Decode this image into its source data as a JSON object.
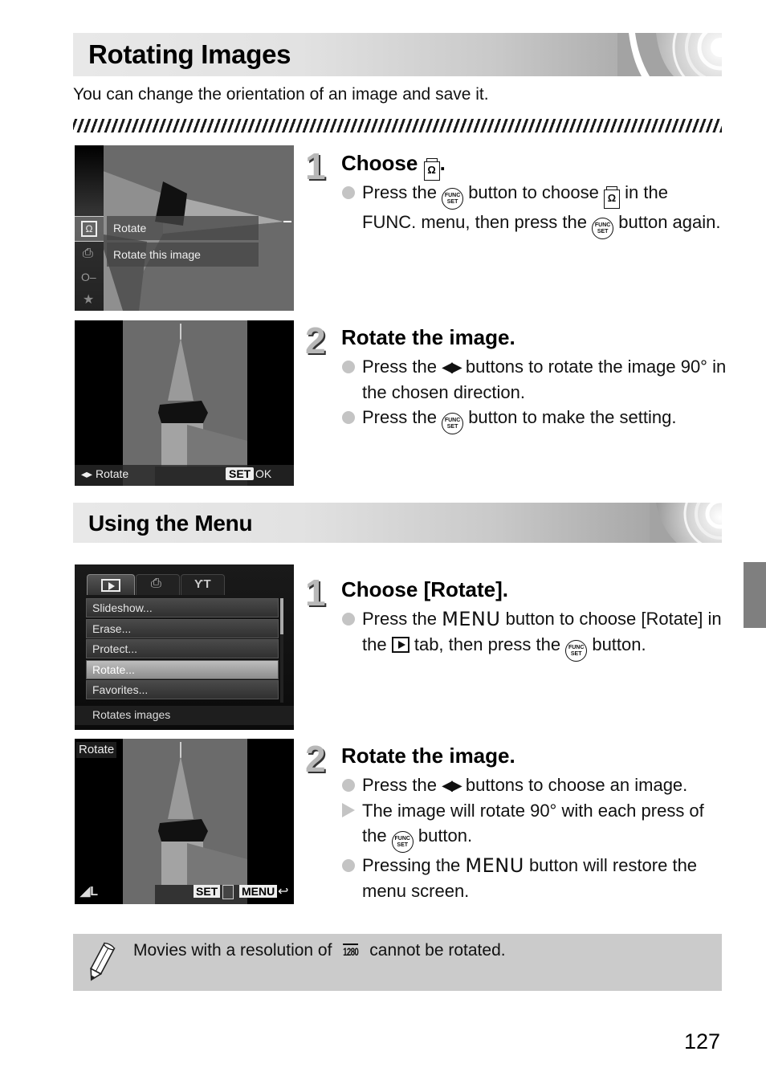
{
  "page": {
    "number": "127",
    "side_tab_color": "#7f7f7f"
  },
  "section1": {
    "title": "Rotating Images",
    "intro": "You can change the orientation of an image and save it.",
    "steps": [
      {
        "number": "1",
        "title": "Choose",
        "title_icon": "rotate-icon",
        "title_suffix": ".",
        "bullets": [
          {
            "marker": "circle",
            "parts": [
              "Press the",
              "button to choose",
              "in the FUNC. menu, then press the",
              "button again."
            ]
          }
        ],
        "screen": {
          "menu_items": [
            "Rotate",
            "Rotate this image"
          ],
          "side_icons": [
            "rotate-icon",
            "print-icon",
            "key-icon",
            "star-icon"
          ]
        }
      },
      {
        "number": "2",
        "title": "Rotate the image.",
        "bullets": [
          {
            "marker": "circle",
            "parts": [
              "Press the",
              "buttons to rotate the image 90° in the chosen direction."
            ]
          },
          {
            "marker": "circle",
            "parts": [
              "Press the",
              "button to make the setting."
            ]
          }
        ],
        "screen": {
          "bottom_left": "Rotate",
          "set_label": "SET",
          "ok_label": "OK"
        }
      }
    ]
  },
  "section2": {
    "title": "Using the Menu",
    "steps": [
      {
        "number": "1",
        "title": "Choose [Rotate].",
        "bullets": [
          {
            "marker": "circle",
            "parts": [
              "Press the",
              "MENU",
              "button to choose [Rotate] in the",
              "tab, then press the",
              "button."
            ]
          }
        ],
        "screen": {
          "tabs": [
            "play-tab",
            "print-tab",
            "settings-tab"
          ],
          "menu_items": [
            "Slideshow...",
            "Erase...",
            "Protect...",
            "Rotate...",
            "Favorites..."
          ],
          "selected_index": 3,
          "help_text": "Rotates images"
        }
      },
      {
        "number": "2",
        "title": "Rotate the image.",
        "bullets": [
          {
            "marker": "circle",
            "parts": [
              "Press the",
              "buttons to choose an image."
            ]
          },
          {
            "marker": "triangle",
            "parts": [
              "The image will rotate 90° with each press of the",
              "button."
            ]
          },
          {
            "marker": "circle",
            "parts": [
              "Pressing the",
              "MENU",
              "button will restore the menu screen."
            ]
          }
        ],
        "screen": {
          "top_label": "Rotate",
          "set_label": "SET",
          "menu_label": "MENU"
        }
      }
    ]
  },
  "note": {
    "text_before": "Movies with a resolution of",
    "icon_label": "1280",
    "text_after": "cannot be rotated."
  },
  "icons": {
    "func_set_top": "FUNC",
    "func_set_bottom": "SET",
    "rotate_glyph": "Ω"
  }
}
